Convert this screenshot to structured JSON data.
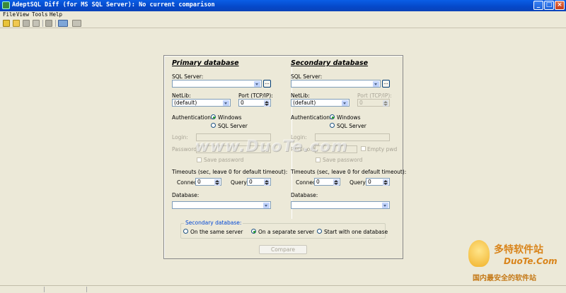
{
  "window": {
    "title": "AdeptSQL Diff (for MS SQL Server): No current comparison",
    "minimize": "_",
    "maximize": "□",
    "close": "×"
  },
  "menu": [
    "File",
    "View",
    "Tools",
    "Help"
  ],
  "primary": {
    "header": "Primary database",
    "sql_server_label": "SQL Server:",
    "sql_server_value": "",
    "browse": "...",
    "netlib_label": "NetLib:",
    "netlib_value": "(default)",
    "port_label": "Port (TCP/IP):",
    "port_value": "0",
    "auth_label": "Authentication:",
    "auth_windows": "Windows",
    "auth_sql": "SQL Server",
    "login_label": "Login:",
    "password_label": "Password:",
    "save_password": "Save password",
    "timeouts_label": "Timeouts (sec, leave 0 for default timeout):",
    "connect_label": "Connect:",
    "connect_value": "0",
    "query_label": "Query:",
    "query_value": "0",
    "database_label": "Database:",
    "database_value": ""
  },
  "secondary": {
    "header": "Secondary database",
    "sql_server_label": "SQL Server:",
    "sql_server_value": "",
    "browse": "...",
    "netlib_label": "NetLib:",
    "netlib_value": "(default)",
    "port_label": "Port (TCP/IP):",
    "port_value": "0",
    "auth_label": "Authentication:",
    "auth_windows": "Windows",
    "auth_sql": "SQL Server",
    "login_label": "Login:",
    "password_label": "Password:",
    "empty_pwd": "Empty pwd",
    "save_password": "Save password",
    "timeouts_label": "Timeouts (sec, leave 0 for default timeout):",
    "connect_label": "Connect:",
    "connect_value": "0",
    "query_label": "Query:",
    "query_value": "0",
    "database_label": "Database:",
    "database_value": ""
  },
  "secondary_mode": {
    "caption": "Secondary database:",
    "options": [
      "On the same server",
      "On a separate server",
      "Start with one database"
    ],
    "selected": "On a separate server"
  },
  "compare_button": "Compare",
  "watermark": "www.DuoTe.com",
  "logo": {
    "cn": "多特软件站",
    "en": "DuoTe.Com",
    "tagline": "国内最安全的软件站"
  }
}
